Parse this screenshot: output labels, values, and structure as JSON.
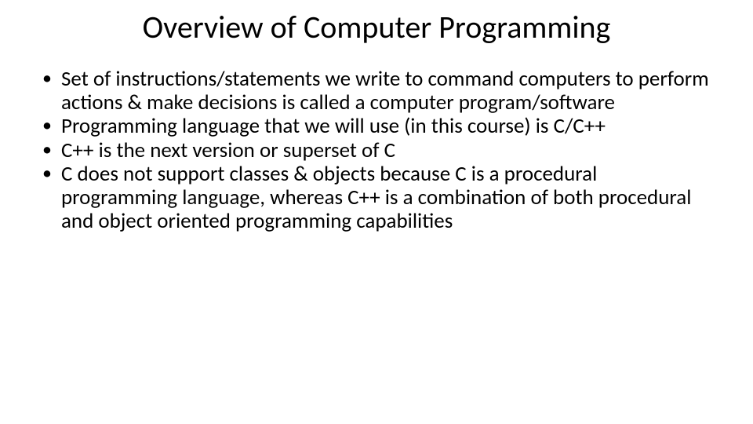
{
  "title": "Overview of Computer Programming",
  "bullets": [
    "Set of instructions/statements we write to command computers to perform actions & make decisions is called a computer program/software",
    "Programming language that we will use (in this course) is C/C++",
    "C++ is the next version or superset of C",
    "C does not support classes & objects because C is a procedural programming language, whereas C++ is a combination of both procedural and object oriented programming capabilities"
  ]
}
